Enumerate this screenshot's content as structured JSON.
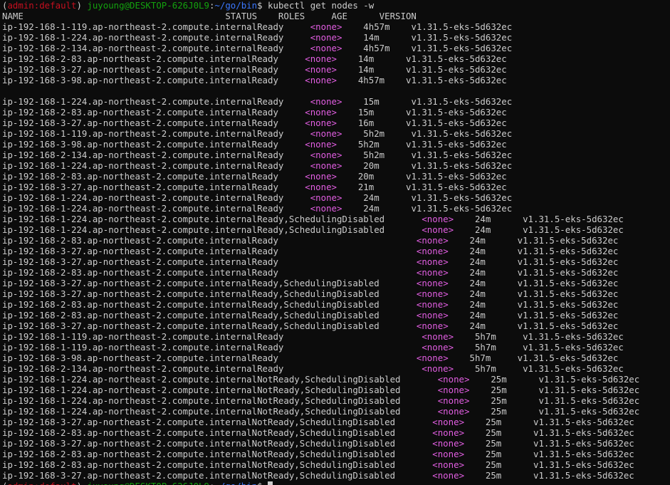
{
  "prompt": {
    "env_open": "(",
    "env_name": "admin:default",
    "env_close": ") ",
    "user_host": "juyoung@DESKTOP-626J0L9",
    "colon": ":",
    "path": "~/go/bin",
    "dollar": "$ ",
    "command": "kubectl get nodes -w"
  },
  "colors": {
    "background": "#0c0c0c",
    "foreground": "#cccccc",
    "env": "#c50f1f",
    "user_host": "#13a10e",
    "path": "#3b78ff",
    "roles": "#e25ee2"
  },
  "header": {
    "name": "NAME",
    "status": "STATUS",
    "roles": "ROLES",
    "age": "AGE",
    "version": "VERSION"
  },
  "blocks": [
    {
      "name_width": 42,
      "status_width": 10,
      "roles_width": 10,
      "age_width": 9,
      "rows": [
        {
          "name": "ip-192-168-1-119.ap-northeast-2.compute.internal",
          "status": "Ready",
          "roles": "<none>",
          "age": "4h57m",
          "version": "v1.31.5-eks-5d632ec"
        },
        {
          "name": "ip-192-168-1-224.ap-northeast-2.compute.internal",
          "status": "Ready",
          "roles": "<none>",
          "age": "14m",
          "version": "v1.31.5-eks-5d632ec"
        },
        {
          "name": "ip-192-168-2-134.ap-northeast-2.compute.internal",
          "status": "Ready",
          "roles": "<none>",
          "age": "4h57m",
          "version": "v1.31.5-eks-5d632ec"
        },
        {
          "name": "ip-192-168-2-83.ap-northeast-2.compute.internal",
          "status": "Ready",
          "roles": "<none>",
          "age": "14m",
          "version": "v1.31.5-eks-5d632ec"
        },
        {
          "name": "ip-192-168-3-27.ap-northeast-2.compute.internal",
          "status": "Ready",
          "roles": "<none>",
          "age": "14m",
          "version": "v1.31.5-eks-5d632ec"
        },
        {
          "name": "ip-192-168-3-98.ap-northeast-2.compute.internal",
          "status": "Ready",
          "roles": "<none>",
          "age": "4h57m",
          "version": "v1.31.5-eks-5d632ec"
        }
      ]
    },
    {
      "blank_before": true,
      "name_width": 42,
      "status_width": 10,
      "roles_width": 10,
      "age_width": 9,
      "rows": [
        {
          "name": "ip-192-168-1-224.ap-northeast-2.compute.internal",
          "status": "Ready",
          "roles": "<none>",
          "age": "15m",
          "version": "v1.31.5-eks-5d632ec"
        },
        {
          "name": "ip-192-168-2-83.ap-northeast-2.compute.internal",
          "status": "Ready",
          "roles": "<none>",
          "age": "15m",
          "version": "v1.31.5-eks-5d632ec"
        },
        {
          "name": "ip-192-168-3-27.ap-northeast-2.compute.internal",
          "status": "Ready",
          "roles": "<none>",
          "age": "16m",
          "version": "v1.31.5-eks-5d632ec"
        },
        {
          "name": "ip-192-168-1-119.ap-northeast-2.compute.internal",
          "status": "Ready",
          "roles": "<none>",
          "age": "5h2m",
          "version": "v1.31.5-eks-5d632ec"
        },
        {
          "name": "ip-192-168-3-98.ap-northeast-2.compute.internal",
          "status": "Ready",
          "roles": "<none>",
          "age": "5h2m",
          "version": "v1.31.5-eks-5d632ec"
        },
        {
          "name": "ip-192-168-2-134.ap-northeast-2.compute.internal",
          "status": "Ready",
          "roles": "<none>",
          "age": "5h2m",
          "version": "v1.31.5-eks-5d632ec"
        },
        {
          "name": "ip-192-168-1-224.ap-northeast-2.compute.internal",
          "status": "Ready",
          "roles": "<none>",
          "age": "20m",
          "version": "v1.31.5-eks-5d632ec"
        },
        {
          "name": "ip-192-168-2-83.ap-northeast-2.compute.internal",
          "status": "Ready",
          "roles": "<none>",
          "age": "20m",
          "version": "v1.31.5-eks-5d632ec"
        },
        {
          "name": "ip-192-168-3-27.ap-northeast-2.compute.internal",
          "status": "Ready",
          "roles": "<none>",
          "age": "21m",
          "version": "v1.31.5-eks-5d632ec"
        },
        {
          "name": "ip-192-168-1-224.ap-northeast-2.compute.internal",
          "status": "Ready",
          "roles": "<none>",
          "age": "24m",
          "version": "v1.31.5-eks-5d632ec"
        },
        {
          "name": "ip-192-168-1-224.ap-northeast-2.compute.internal",
          "status": "Ready",
          "roles": "<none>",
          "age": "24m",
          "version": "v1.31.5-eks-5d632ec"
        }
      ]
    },
    {
      "name_width": 42,
      "status_width": 31,
      "roles_width": 10,
      "age_width": 9,
      "rows": [
        {
          "name": "ip-192-168-1-224.ap-northeast-2.compute.internal",
          "status": "Ready,SchedulingDisabled",
          "roles": "<none>",
          "age": "24m",
          "version": "v1.31.5-eks-5d632ec"
        },
        {
          "name": "ip-192-168-1-224.ap-northeast-2.compute.internal",
          "status": "Ready,SchedulingDisabled",
          "roles": "<none>",
          "age": "24m",
          "version": "v1.31.5-eks-5d632ec"
        },
        {
          "name": "ip-192-168-2-83.ap-northeast-2.compute.internal",
          "status": "Ready",
          "roles": "<none>",
          "age": "24m",
          "version": "v1.31.5-eks-5d632ec"
        },
        {
          "name": "ip-192-168-3-27.ap-northeast-2.compute.internal",
          "status": "Ready",
          "roles": "<none>",
          "age": "24m",
          "version": "v1.31.5-eks-5d632ec"
        },
        {
          "name": "ip-192-168-3-27.ap-northeast-2.compute.internal",
          "status": "Ready",
          "roles": "<none>",
          "age": "24m",
          "version": "v1.31.5-eks-5d632ec"
        },
        {
          "name": "ip-192-168-2-83.ap-northeast-2.compute.internal",
          "status": "Ready",
          "roles": "<none>",
          "age": "24m",
          "version": "v1.31.5-eks-5d632ec"
        },
        {
          "name": "ip-192-168-3-27.ap-northeast-2.compute.internal",
          "status": "Ready,SchedulingDisabled",
          "roles": "<none>",
          "age": "24m",
          "version": "v1.31.5-eks-5d632ec"
        },
        {
          "name": "ip-192-168-3-27.ap-northeast-2.compute.internal",
          "status": "Ready,SchedulingDisabled",
          "roles": "<none>",
          "age": "24m",
          "version": "v1.31.5-eks-5d632ec"
        },
        {
          "name": "ip-192-168-2-83.ap-northeast-2.compute.internal",
          "status": "Ready,SchedulingDisabled",
          "roles": "<none>",
          "age": "24m",
          "version": "v1.31.5-eks-5d632ec"
        },
        {
          "name": "ip-192-168-2-83.ap-northeast-2.compute.internal",
          "status": "Ready,SchedulingDisabled",
          "roles": "<none>",
          "age": "24m",
          "version": "v1.31.5-eks-5d632ec"
        },
        {
          "name": "ip-192-168-3-27.ap-northeast-2.compute.internal",
          "status": "Ready,SchedulingDisabled",
          "roles": "<none>",
          "age": "24m",
          "version": "v1.31.5-eks-5d632ec"
        },
        {
          "name": "ip-192-168-1-119.ap-northeast-2.compute.internal",
          "status": "Ready",
          "roles": "<none>",
          "age": "5h7m",
          "version": "v1.31.5-eks-5d632ec"
        },
        {
          "name": "ip-192-168-1-119.ap-northeast-2.compute.internal",
          "status": "Ready",
          "roles": "<none>",
          "age": "5h7m",
          "version": "v1.31.5-eks-5d632ec"
        },
        {
          "name": "ip-192-168-3-98.ap-northeast-2.compute.internal",
          "status": "Ready",
          "roles": "<none>",
          "age": "5h7m",
          "version": "v1.31.5-eks-5d632ec"
        },
        {
          "name": "ip-192-168-2-134.ap-northeast-2.compute.internal",
          "status": "Ready",
          "roles": "<none>",
          "age": "5h7m",
          "version": "v1.31.5-eks-5d632ec"
        }
      ]
    },
    {
      "name_width": 42,
      "status_width": 34,
      "roles_width": 10,
      "age_width": 9,
      "rows": [
        {
          "name": "ip-192-168-1-224.ap-northeast-2.compute.internal",
          "status": "NotReady,SchedulingDisabled",
          "roles": "<none>",
          "age": "25m",
          "version": "v1.31.5-eks-5d632ec"
        },
        {
          "name": "ip-192-168-1-224.ap-northeast-2.compute.internal",
          "status": "NotReady,SchedulingDisabled",
          "roles": "<none>",
          "age": "25m",
          "version": "v1.31.5-eks-5d632ec"
        },
        {
          "name": "ip-192-168-1-224.ap-northeast-2.compute.internal",
          "status": "NotReady,SchedulingDisabled",
          "roles": "<none>",
          "age": "25m",
          "version": "v1.31.5-eks-5d632ec"
        },
        {
          "name": "ip-192-168-1-224.ap-northeast-2.compute.internal",
          "status": "NotReady,SchedulingDisabled",
          "roles": "<none>",
          "age": "25m",
          "version": "v1.31.5-eks-5d632ec"
        },
        {
          "name": "ip-192-168-3-27.ap-northeast-2.compute.internal",
          "status": "NotReady,SchedulingDisabled",
          "roles": "<none>",
          "age": "25m",
          "version": "v1.31.5-eks-5d632ec"
        },
        {
          "name": "ip-192-168-2-83.ap-northeast-2.compute.internal",
          "status": "NotReady,SchedulingDisabled",
          "roles": "<none>",
          "age": "25m",
          "version": "v1.31.5-eks-5d632ec"
        },
        {
          "name": "ip-192-168-3-27.ap-northeast-2.compute.internal",
          "status": "NotReady,SchedulingDisabled",
          "roles": "<none>",
          "age": "25m",
          "version": "v1.31.5-eks-5d632ec"
        },
        {
          "name": "ip-192-168-2-83.ap-northeast-2.compute.internal",
          "status": "NotReady,SchedulingDisabled",
          "roles": "<none>",
          "age": "25m",
          "version": "v1.31.5-eks-5d632ec"
        },
        {
          "name": "ip-192-168-2-83.ap-northeast-2.compute.internal",
          "status": "NotReady,SchedulingDisabled",
          "roles": "<none>",
          "age": "25m",
          "version": "v1.31.5-eks-5d632ec"
        },
        {
          "name": "ip-192-168-3-27.ap-northeast-2.compute.internal",
          "status": "NotReady,SchedulingDisabled",
          "roles": "<none>",
          "age": "25m",
          "version": "v1.31.5-eks-5d632ec"
        }
      ]
    }
  ]
}
